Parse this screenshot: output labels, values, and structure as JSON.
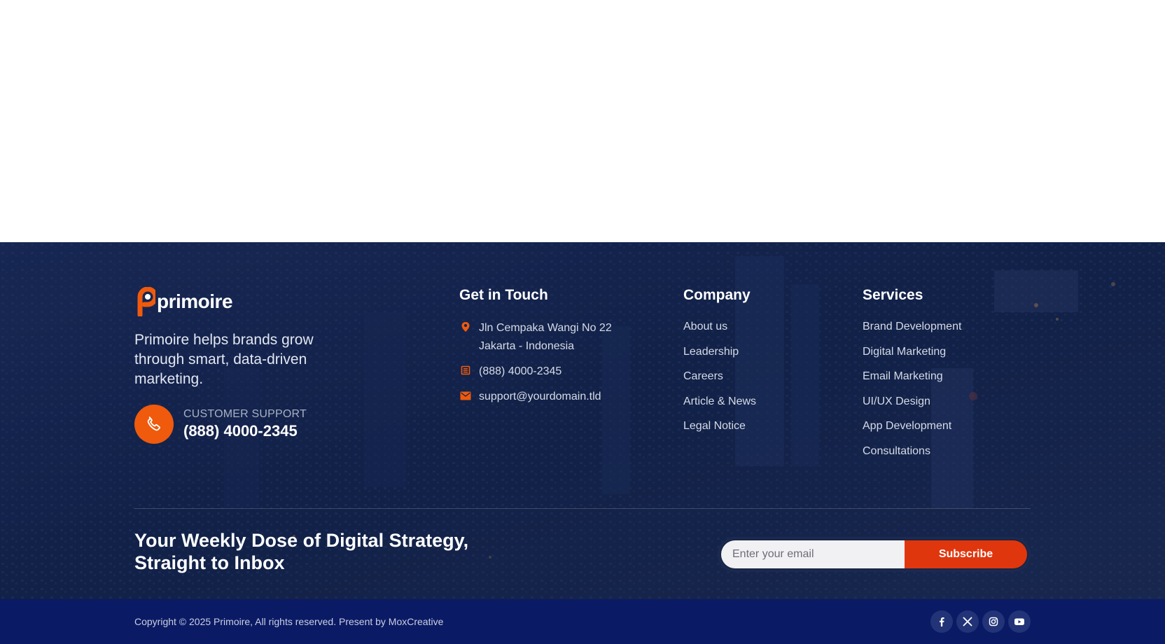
{
  "brand": {
    "logo_text": "primoire",
    "tagline": "Primoire helps brands grow through smart, data-driven marketing.",
    "support_label": "CUSTOMER SUPPORT",
    "support_number": "(888) 4000-2345",
    "logo_icon": "logo-mark-icon",
    "support_icon": "phone-icon"
  },
  "contact": {
    "title": "Get in Touch",
    "address": "Jln Cempaka Wangi No 22 Jakarta - Indonesia",
    "phone": "(888) 4000-2345",
    "email": "support@yourdomain.tld"
  },
  "company": {
    "title": "Company",
    "links": [
      "About us",
      "Leadership",
      "Careers",
      "Article & News",
      "Legal Notice"
    ]
  },
  "services": {
    "title": "Services",
    "links": [
      "Brand Development",
      "Digital Marketing",
      "Email Marketing",
      "UI/UX Design",
      "App Development",
      "Consultations"
    ]
  },
  "newsletter": {
    "title": "Your Weekly Dose of Digital Strategy, Straight to Inbox",
    "placeholder": "Enter your email",
    "button_label": "Subscribe"
  },
  "footer_bottom": {
    "copyright": "Copyright © 2025 Primoire, All rights reserved. Present by MoxCreative",
    "social_icons": [
      "facebook-icon",
      "x-icon",
      "instagram-icon",
      "youtube-icon"
    ]
  },
  "colors": {
    "accent": "#ef5a0c",
    "subscribe_button": "#e0360e",
    "footer_bg": "#15254e",
    "bottom_bar_bg": "#0b1a64"
  }
}
